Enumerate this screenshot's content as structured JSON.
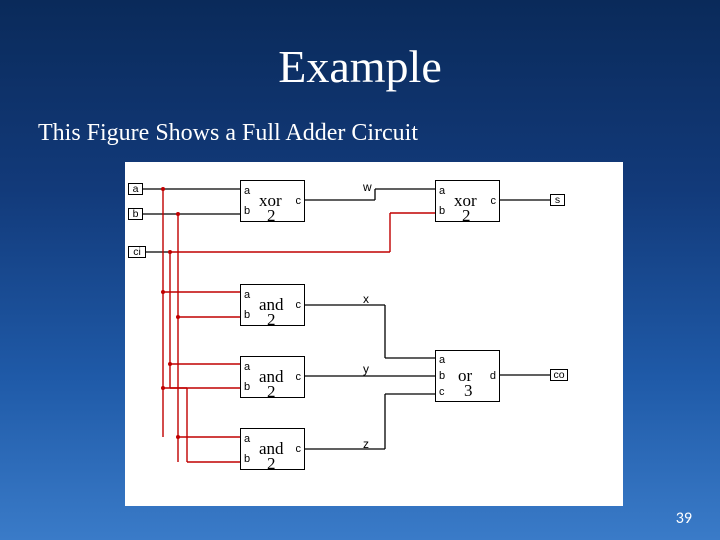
{
  "title": "Example",
  "subtitle": "This Figure Shows a Full Adder Circuit",
  "page_number": "39",
  "inputs": {
    "a": "a",
    "b": "b",
    "ci": "ci"
  },
  "outputs": {
    "s": "s",
    "co": "co"
  },
  "wires": {
    "w": "w",
    "x": "x",
    "y": "y",
    "z": "z"
  },
  "ports": {
    "a": "a",
    "b": "b",
    "c": "c",
    "d": "d"
  },
  "gates": {
    "xor2_1": {
      "name": "xor",
      "arity": "2"
    },
    "xor2_2": {
      "name": "xor",
      "arity": "2"
    },
    "and2_1": {
      "name": "and",
      "arity": "2"
    },
    "and2_2": {
      "name": "and",
      "arity": "2"
    },
    "and2_3": {
      "name": "and",
      "arity": "2"
    },
    "or3": {
      "name": "or",
      "arity": "3"
    }
  }
}
